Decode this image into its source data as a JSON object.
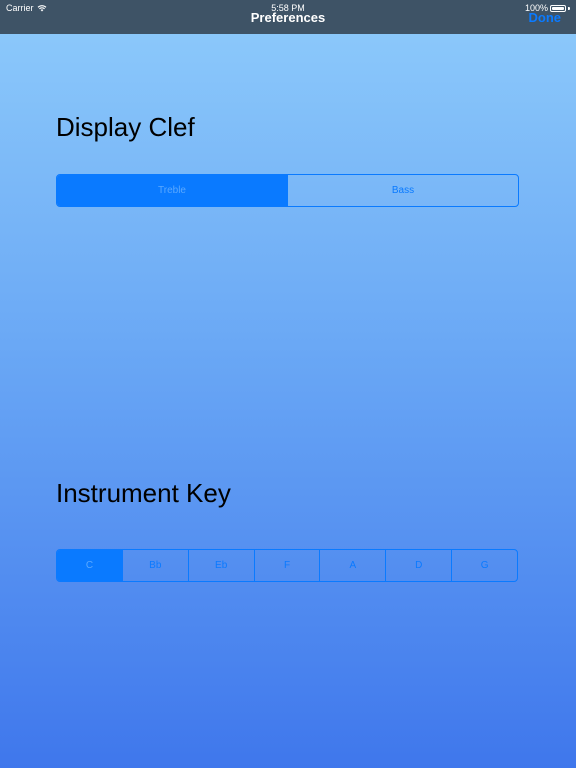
{
  "status_bar": {
    "carrier": "Carrier",
    "time": "5:58 PM",
    "battery": "100%"
  },
  "nav": {
    "title": "Preferences",
    "done_label": "Done"
  },
  "display_clef": {
    "title": "Display Clef",
    "options": [
      "Treble",
      "Bass"
    ],
    "selected": "Treble"
  },
  "instrument_key": {
    "title": "Instrument Key",
    "options": [
      "C",
      "Bb",
      "Eb",
      "F",
      "A",
      "D",
      "G"
    ],
    "selected": "C"
  },
  "colors": {
    "accent": "#0a7aff",
    "navbar": "#3e5366",
    "gradient_top": "#8ecbfb",
    "gradient_bottom": "#3f77ec"
  },
  "icons": {
    "wifi": "wifi-icon",
    "battery": "battery-icon"
  }
}
